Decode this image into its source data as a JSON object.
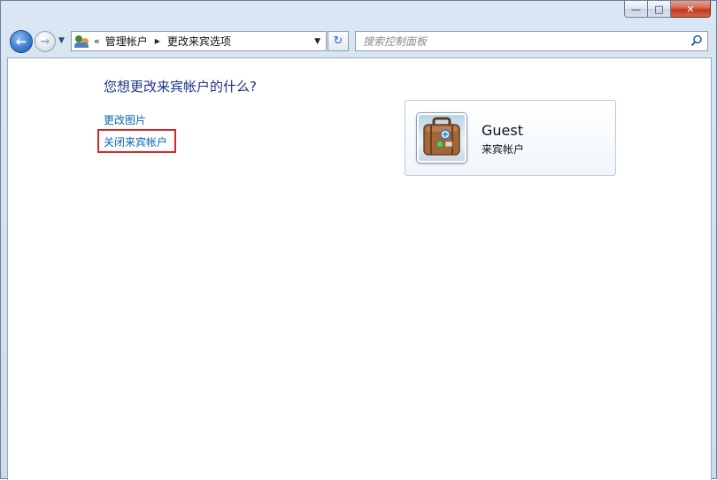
{
  "window": {
    "caption_buttons": {
      "minimize": "—",
      "maximize": "□",
      "close": "✕"
    }
  },
  "nav": {
    "back_icon": "←",
    "forward_icon": "→",
    "history_dropdown": "▼"
  },
  "address": {
    "overflow": "«",
    "crumbs": [
      "管理帐户",
      "更改来宾选项"
    ],
    "separator": "▶",
    "dropdown": "▼"
  },
  "refresh_icon": "↻",
  "search": {
    "placeholder": "搜索控制面板",
    "value": ""
  },
  "main": {
    "question": "您想更改来宾帐户的什么?",
    "links": {
      "change_picture": "更改图片",
      "turn_off_guest": "关闭来宾帐户"
    },
    "account": {
      "name": "Guest",
      "type": "来宾帐户"
    }
  },
  "colors": {
    "link": "#0b66b3",
    "heading": "#1e3287",
    "highlight_border": "#d8262b"
  }
}
